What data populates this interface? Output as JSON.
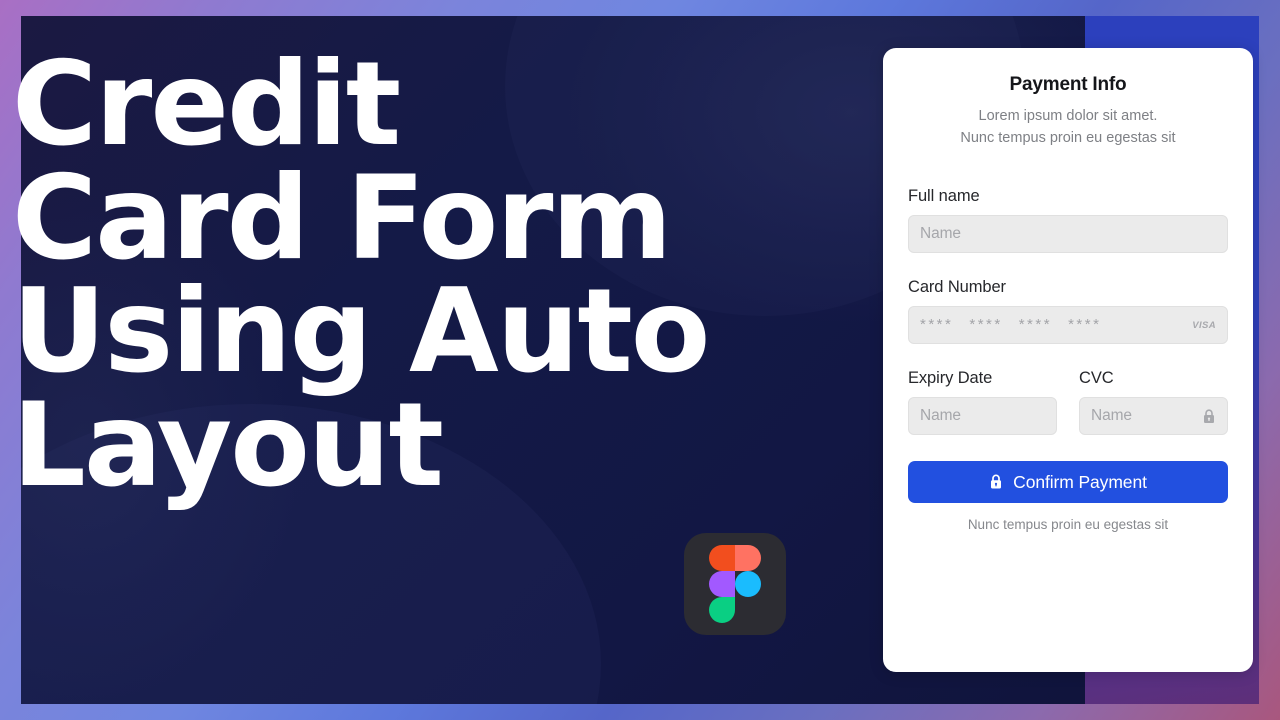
{
  "thumbnail": {
    "headline_lines": [
      "Credit",
      "Card Form",
      "Using Auto",
      "Layout"
    ],
    "brand_logo": "figma-logo",
    "colors": {
      "frame_gradient_start": "#a96fc4",
      "frame_gradient_mid": "#6f86e0",
      "frame_gradient_end": "#a9577e",
      "panel_navy": "#141a47",
      "right_block_blue": "#2c40bd",
      "accent_button_blue": "#2250e0"
    }
  },
  "payment_card": {
    "title": "Payment Info",
    "subtitle_line1": "Lorem ipsum dolor sit amet.",
    "subtitle_line2": "Nunc tempus proin eu egestas sit",
    "fields": {
      "full_name": {
        "label": "Full name",
        "placeholder": "Name",
        "value": ""
      },
      "card_number": {
        "label": "Card Number",
        "masked_groups": [
          "****",
          "****",
          "****",
          "****"
        ],
        "brand_badge": "VISA",
        "value": ""
      },
      "expiry_date": {
        "label": "Expiry Date",
        "placeholder": "Name",
        "value": ""
      },
      "cvc": {
        "label": "CVC",
        "placeholder": "Name",
        "value": "",
        "icon": "lock-icon"
      }
    },
    "confirm_button": {
      "label": "Confirm Payment",
      "icon": "lock-icon"
    },
    "footnote": "Nunc tempus proin eu egestas sit"
  }
}
